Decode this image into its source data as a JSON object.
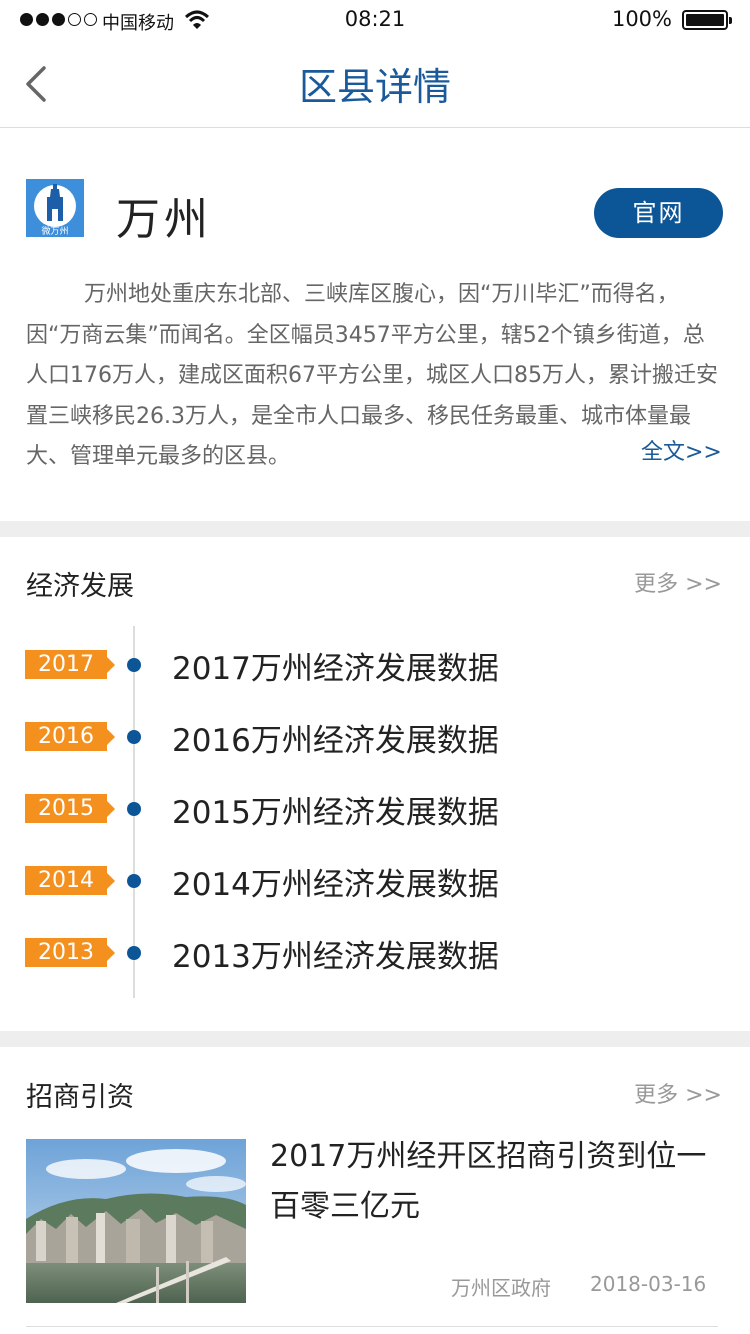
{
  "status_bar": {
    "carrier": "中国移动",
    "time": "08:21",
    "battery": "100%"
  },
  "nav": {
    "title": "区县详情"
  },
  "district": {
    "logo_text": "微万州",
    "name": "万州",
    "official_button": "官网",
    "description": "万州地处重庆东北部、三峡库区腹心，因“万川毕汇”而得名，因“万商云集”而闻名。全区幅员3457平方公里，辖52个镇乡街道，总人口176万人，建成区面积67平方公里，城区人口85万人，累计搬迁安置三峡移民26.3万人，是全市人口最多、移民任务最重、城市体量最大、管理单元最多的区县。",
    "full_text_link": "全文>>"
  },
  "economy": {
    "title": "经济发展",
    "more": "更多 >>",
    "items": [
      {
        "year": "2017",
        "label": "2017万州经济发展数据"
      },
      {
        "year": "2016",
        "label": "2016万州经济发展数据"
      },
      {
        "year": "2015",
        "label": "2015万州经济发展数据"
      },
      {
        "year": "2014",
        "label": "2014万州经济发展数据"
      },
      {
        "year": "2013",
        "label": "2013万州经济发展数据"
      }
    ]
  },
  "investment": {
    "title": "招商引资",
    "more": "更多 >>",
    "news": {
      "title": "2017万州经开区招商引资到位一百零三亿元",
      "source": "万州区政府",
      "date": "2018-03-16"
    }
  },
  "colors": {
    "accent_blue": "#0c5596",
    "title_blue": "#1a5a9a",
    "badge_orange": "#f4901e"
  }
}
